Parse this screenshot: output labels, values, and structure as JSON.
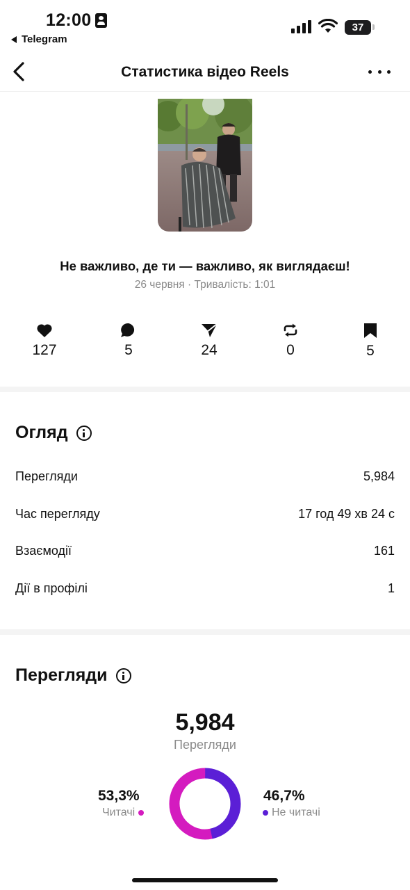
{
  "status_bar": {
    "time": "12:00",
    "back_app": "Telegram",
    "battery": "37"
  },
  "nav": {
    "title": "Статистика відео Reels"
  },
  "reel": {
    "title": "Не важливо, де ти — важливо, як виглядаєш!",
    "meta": "26 червня · Тривалість: 1:01"
  },
  "engagement": [
    {
      "icon": "heart-icon",
      "value": "127"
    },
    {
      "icon": "comment-icon",
      "value": "5"
    },
    {
      "icon": "share-icon",
      "value": "24"
    },
    {
      "icon": "repost-icon",
      "value": "0"
    },
    {
      "icon": "bookmark-icon",
      "value": "5"
    }
  ],
  "overview": {
    "title": "Огляд",
    "rows": [
      {
        "label": "Перегляди",
        "value": "5,984"
      },
      {
        "label": "Час перегляду",
        "value": "17 год 49 хв 24 с"
      },
      {
        "label": "Взаємодії",
        "value": "161"
      },
      {
        "label": "Дії в профілі",
        "value": "1"
      }
    ]
  },
  "views": {
    "title": "Перегляди",
    "total": "5,984",
    "caption": "Перегляди",
    "followers": {
      "percent": "53,3%",
      "label": "Читачі",
      "fraction": 0.533,
      "color": "#d41bbf"
    },
    "non_followers": {
      "percent": "46,7%",
      "label": "Не читачі",
      "fraction": 0.467,
      "color": "#5b1fd6"
    }
  }
}
